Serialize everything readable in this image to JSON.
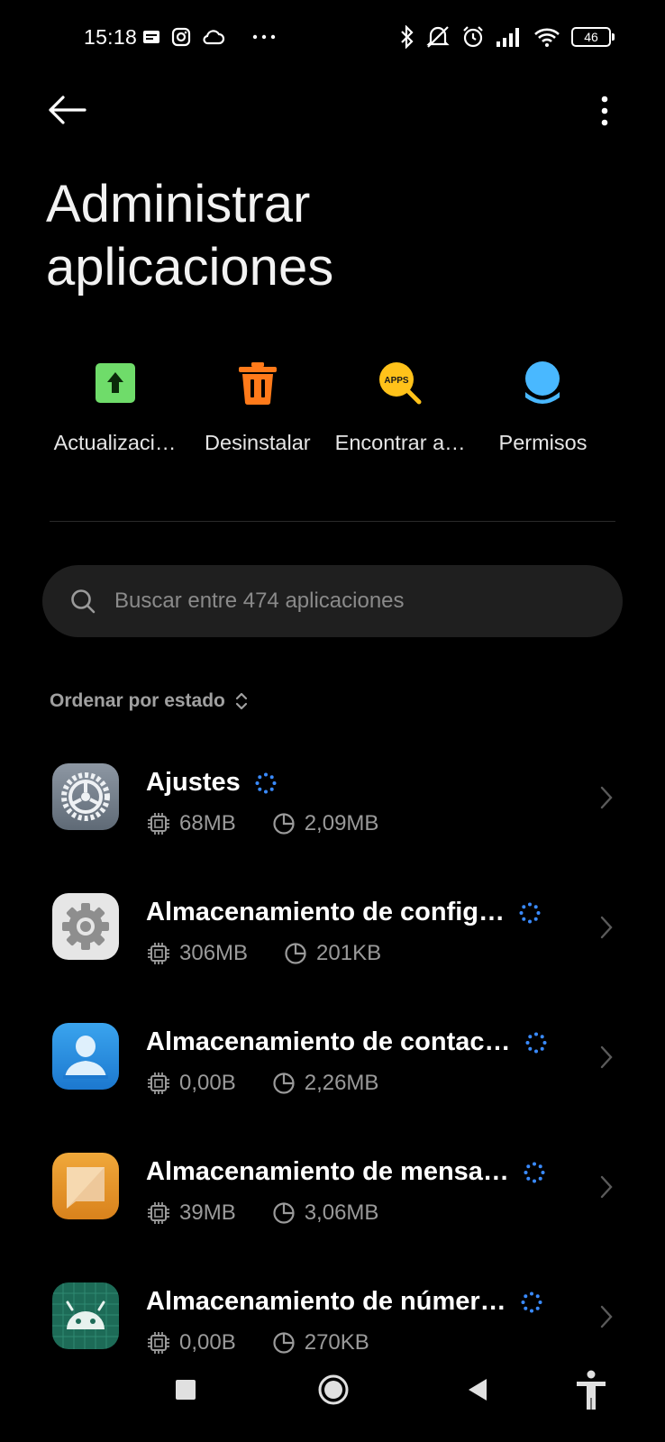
{
  "status_bar": {
    "time": "15:18",
    "battery": "46"
  },
  "header": {
    "title_line1": "Administrar",
    "title_line2": "aplicaciones"
  },
  "quick_actions": [
    {
      "label": "Actualizaci…",
      "icon": "update-arrow-icon",
      "color": "#6fdc6a"
    },
    {
      "label": "Desinstalar",
      "icon": "trash-icon",
      "color": "#ff7a1a"
    },
    {
      "label": "Encontrar a…",
      "icon": "find-apps-icon",
      "color": "#ffc21a"
    },
    {
      "label": "Permisos",
      "icon": "permissions-icon",
      "color": "#49b8ff"
    }
  ],
  "search": {
    "placeholder": "Buscar entre 474 aplicaciones"
  },
  "sort": {
    "label": "Ordenar por estado"
  },
  "apps": [
    {
      "name": "Ajustes",
      "ram": "68MB",
      "storage": "2,09MB",
      "icon": "settings-app-icon"
    },
    {
      "name": "Almacenamiento de config…",
      "ram": "306MB",
      "storage": "201KB",
      "icon": "gear-app-icon"
    },
    {
      "name": "Almacenamiento de contac…",
      "ram": "0,00B",
      "storage": "2,26MB",
      "icon": "contacts-app-icon"
    },
    {
      "name": "Almacenamiento de mensa…",
      "ram": "39MB",
      "storage": "3,06MB",
      "icon": "messages-app-icon"
    },
    {
      "name": "Almacenamiento de númer…",
      "ram": "0,00B",
      "storage": "270KB",
      "icon": "android-app-icon"
    }
  ],
  "colors": {
    "accent": "#3a8bff",
    "background": "#000000",
    "secondary_text": "#9a9a9a"
  }
}
